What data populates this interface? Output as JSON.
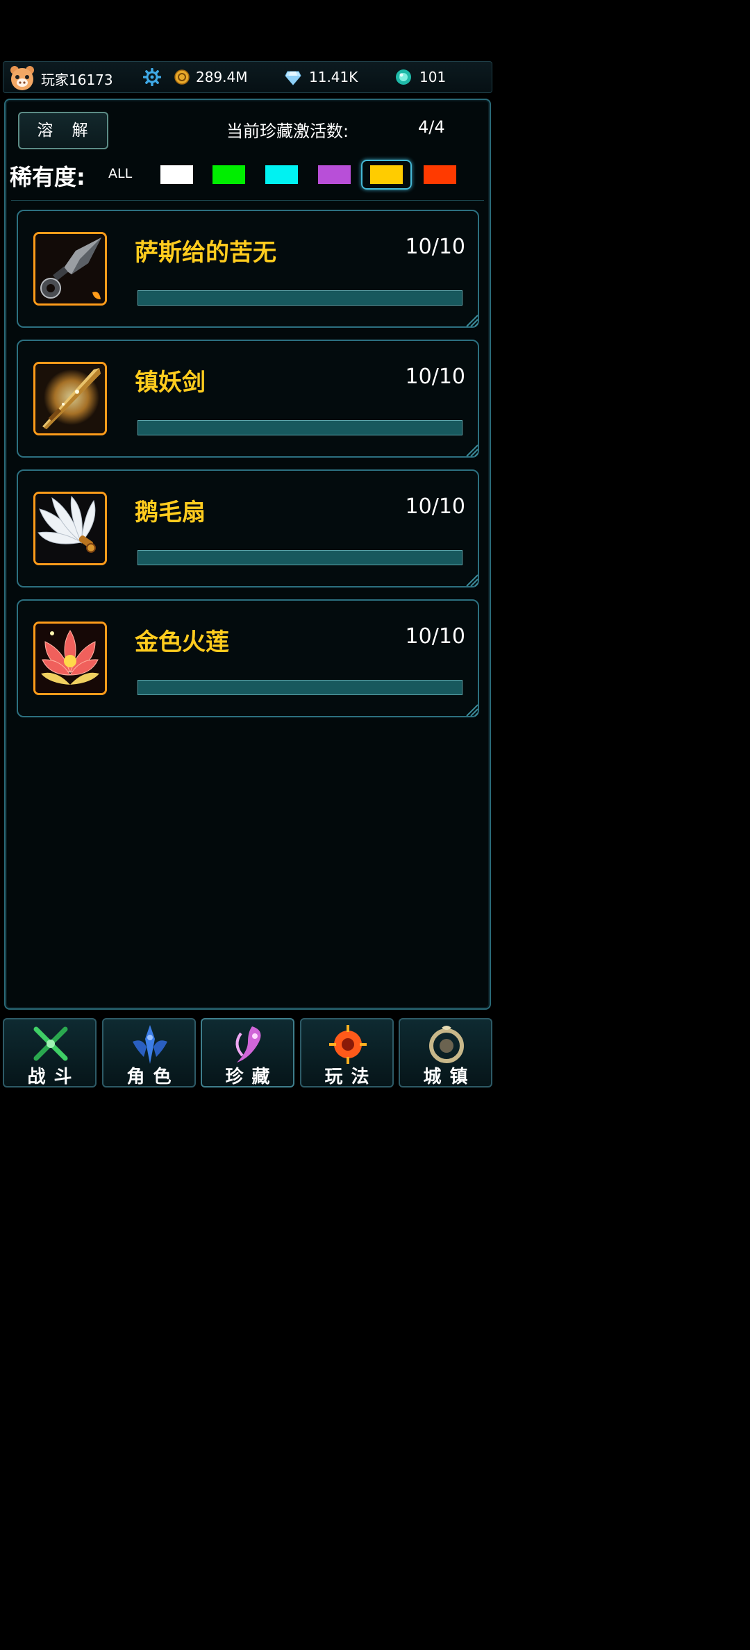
{
  "header": {
    "player_name": "玩家16173",
    "coins": "289.4M",
    "diamonds": "11.41K",
    "orbs": "101",
    "icons": [
      "pig-avatar-icon",
      "gear-icon",
      "coin-icon",
      "diamond-icon",
      "orb-icon"
    ]
  },
  "toolbar": {
    "dissolve_label": "溶 解",
    "activation_label": "当前珍藏激活数:",
    "activation_count": "4/4"
  },
  "rarity_filter": {
    "label": "稀有度:",
    "all_label": "ALL",
    "colors": [
      "#ffffff",
      "#00ee00",
      "#00f2f2",
      "#b84fd8",
      "#ffcc00",
      "#ff3a00"
    ],
    "selected_index": 4
  },
  "items": [
    {
      "name": "萨斯给的苦无",
      "count": "10/10",
      "progress": 1.0,
      "icon": "kunai-icon"
    },
    {
      "name": "镇妖剑",
      "count": "10/10",
      "progress": 1.0,
      "icon": "golden-sword-icon"
    },
    {
      "name": "鹅毛扇",
      "count": "10/10",
      "progress": 1.0,
      "icon": "feather-fan-icon"
    },
    {
      "name": "金色火莲",
      "count": "10/10",
      "progress": 1.0,
      "icon": "fire-lotus-icon"
    }
  ],
  "nav": [
    {
      "label": "战斗",
      "icon": "crossed-swords-icon",
      "color": "#47d36a"
    },
    {
      "label": "角色",
      "icon": "warrior-icon",
      "color": "#3d7ee6"
    },
    {
      "label": "珍藏",
      "icon": "treasure-icon",
      "color": "#d066d8"
    },
    {
      "label": "玩法",
      "icon": "gameplay-icon",
      "color": "#ff5a1a"
    },
    {
      "label": "城镇",
      "icon": "town-icon",
      "color": "#c8b88a"
    }
  ]
}
